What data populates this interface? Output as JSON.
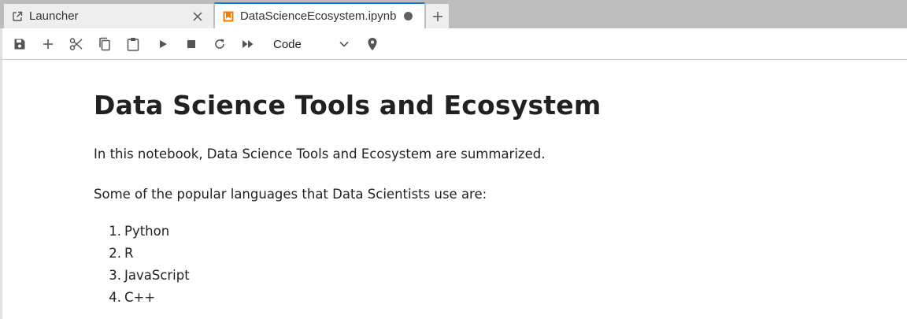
{
  "tabs": {
    "launcher": {
      "label": "Launcher",
      "icon": "external-link-icon"
    },
    "notebook": {
      "label": "DataScienceEcosystem.ipynb",
      "icon": "notebook-icon",
      "icon_color": "#f57c00",
      "unsaved_indicator": true
    },
    "accent_color": "#1976d2"
  },
  "toolbar": {
    "buttons": [
      "save-icon",
      "add-cell-icon",
      "cut-icon",
      "copy-icon",
      "paste-icon",
      "run-icon",
      "stop-icon",
      "restart-icon",
      "run-all-icon"
    ],
    "cell_type": "Code",
    "extra_icon": "map-pin-icon"
  },
  "notebook": {
    "title": "Data Science Tools and Ecosystem",
    "intro": "In this notebook, Data Science Tools and Ecosystem are summarized.",
    "languages_intro": "Some of the popular languages that Data Scientists use are:",
    "languages": [
      {
        "num": "1.",
        "name": "Python"
      },
      {
        "num": "2.",
        "name": "R"
      },
      {
        "num": "3.",
        "name": "JavaScript"
      },
      {
        "num": "4.",
        "name": "C++"
      }
    ]
  }
}
